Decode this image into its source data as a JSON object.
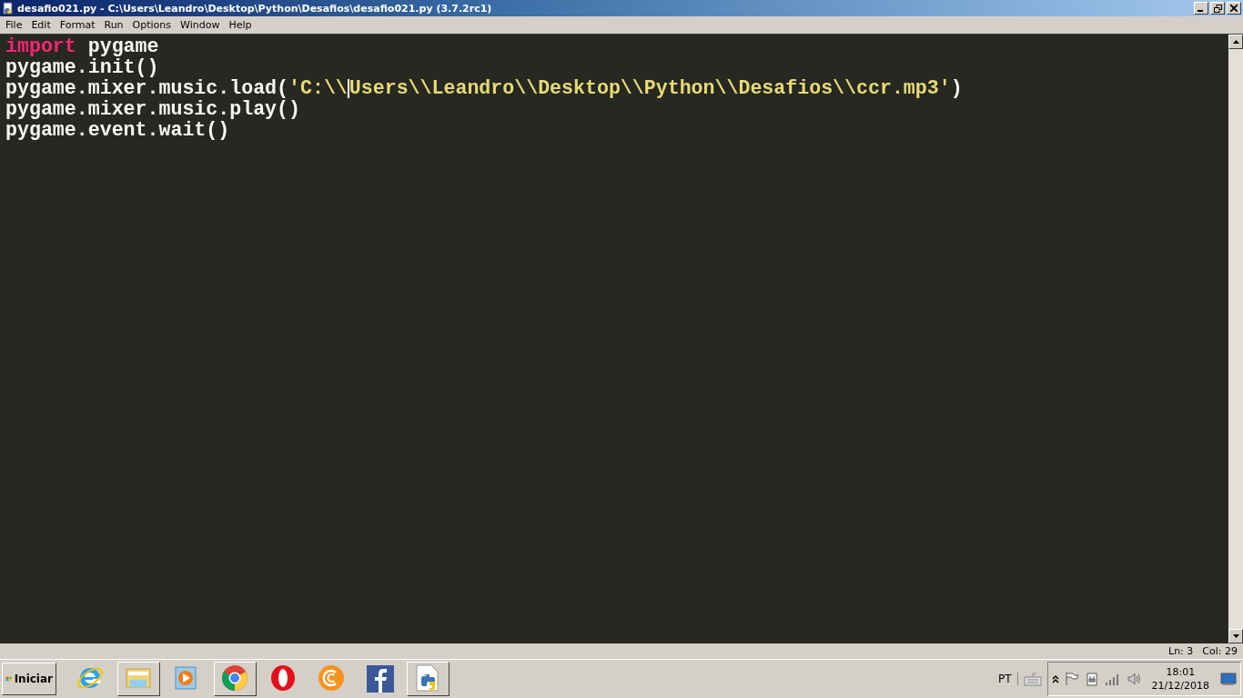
{
  "window": {
    "title": "desafio021.py - C:\\Users\\Leandro\\Desktop\\Python\\Desafios\\desafio021.py (3.7.2rc1)"
  },
  "menu": [
    "File",
    "Edit",
    "Format",
    "Run",
    "Options",
    "Window",
    "Help"
  ],
  "editor": {
    "lines": [
      [
        {
          "kind": "keyword",
          "text": "import"
        },
        {
          "kind": "plain",
          "text": " pygame"
        }
      ],
      [
        {
          "kind": "plain",
          "text": "pygame.init()"
        }
      ],
      [
        {
          "kind": "plain",
          "text": "pygame.mixer.music.load("
        },
        {
          "kind": "string",
          "text": "'C:\\\\"
        },
        {
          "kind": "cursor"
        },
        {
          "kind": "string",
          "text": "Users\\\\Leandro\\\\Desktop\\\\Python\\\\Desafios\\\\ccr.mp3'"
        },
        {
          "kind": "plain",
          "text": ")"
        }
      ],
      [
        {
          "kind": "plain",
          "text": "pygame.mixer.music.play()"
        }
      ],
      [
        {
          "kind": "plain",
          "text": "pygame.event.wait()"
        }
      ]
    ]
  },
  "status_bar": {
    "line": "Ln: 3",
    "column": "Col: 29"
  },
  "taskbar": {
    "start": "Iniciar",
    "apps": [
      {
        "kind": "ie",
        "selected": false
      },
      {
        "kind": "folder",
        "selected": true
      },
      {
        "kind": "media",
        "selected": false
      },
      {
        "kind": "chrome",
        "selected": true
      },
      {
        "kind": "opera",
        "selected": false
      },
      {
        "kind": "ccleaner",
        "selected": false
      },
      {
        "kind": "facebook",
        "selected": false
      },
      {
        "kind": "python",
        "selected": true
      }
    ],
    "language": "PT",
    "time": "18:01",
    "date": "21/12/2018"
  }
}
